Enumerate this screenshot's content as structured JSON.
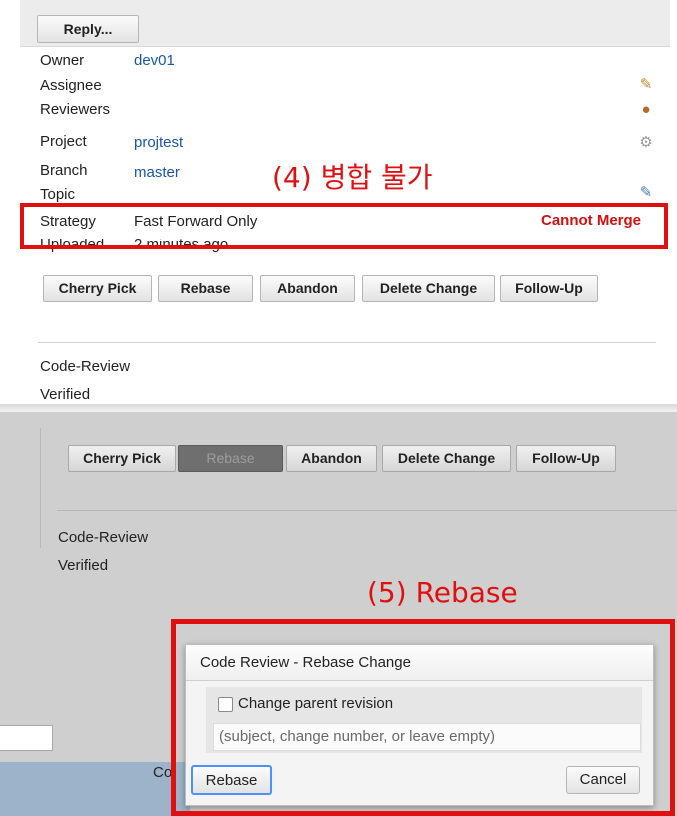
{
  "top": {
    "reply_label": "Reply...",
    "fields": [
      {
        "label": "Owner",
        "value": "dev01"
      },
      {
        "label": "Assignee",
        "value": ""
      },
      {
        "label": "Reviewers",
        "value": ""
      },
      {
        "label": "Project",
        "value": "projtest"
      },
      {
        "label": "Branch",
        "value": "master"
      },
      {
        "label": "Topic",
        "value": ""
      },
      {
        "label": "Strategy",
        "value": "Fast Forward Only"
      },
      {
        "label": "Uploaded",
        "value": "2 minutes ago"
      }
    ],
    "annotation": "(4) 병합 불가",
    "status": "Cannot Merge",
    "actions": [
      "Cherry Pick",
      "Rebase",
      "Abandon",
      "Delete Change",
      "Follow-Up"
    ],
    "labels": [
      "Code-Review",
      "Verified"
    ],
    "icons": [
      "edit-person-icon",
      "reviewers-icon",
      "gear-icon",
      "edit-topic-icon"
    ]
  },
  "bottom": {
    "actions": [
      "Cherry Pick",
      "Rebase",
      "Abandon",
      "Delete Change",
      "Follow-Up"
    ],
    "labels": [
      "Code-Review",
      "Verified"
    ],
    "annotation": "(5) Rebase",
    "background_text": "Co"
  },
  "dialog": {
    "title": "Code Review - Rebase Change",
    "checkbox_label": "Change parent revision",
    "input_placeholder": "(subject, change number, or leave empty)",
    "rebase_label": "Rebase",
    "cancel_label": "Cancel"
  },
  "colors": {
    "annotation_red": "#e01010",
    "link_blue": "#1a56a8",
    "status_red": "#d31010"
  }
}
